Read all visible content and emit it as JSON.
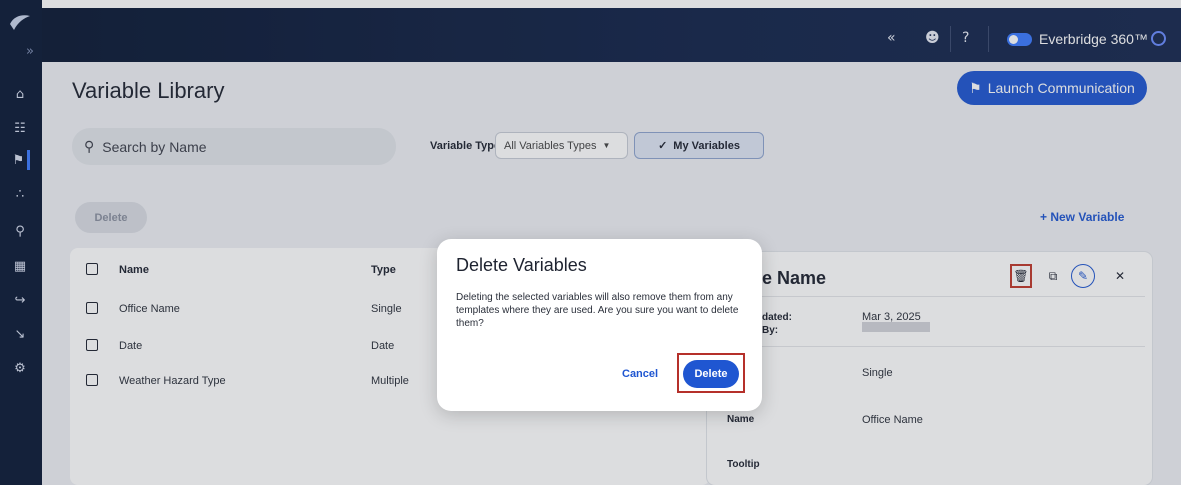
{
  "topbar": {
    "collapse_glyph": "«",
    "brand": "Everbridge 360™",
    "icons": [
      "user-icon",
      "help-icon",
      "toggle-switch",
      "profile-icon"
    ]
  },
  "sidebar": {
    "expand_glyph": "»",
    "items": [
      "home-icon",
      "dashboard-icon",
      "communications-icon",
      "incidents-icon",
      "location-icon",
      "calendar-icon",
      "workflow-icon",
      "reports-icon",
      "settings-icon"
    ]
  },
  "page": {
    "title": "Variable Library",
    "launch_label": "Launch Communication",
    "search_placeholder": "Search by Name",
    "variable_type_label": "Variable Type",
    "variable_type_value": "All Variables Types",
    "my_variables_label": "My Variables",
    "delete_label": "Delete",
    "new_variable_label": "+ New Variable"
  },
  "table": {
    "headers": [
      "Name",
      "Type"
    ],
    "rows": [
      {
        "name": "Office Name",
        "type": "Single"
      },
      {
        "name": "Date",
        "type": "Date"
      },
      {
        "name": "Weather Hazard Type",
        "type": "Multiple"
      }
    ]
  },
  "detail": {
    "title_fragment": "e Name",
    "updated_label": "dated:",
    "updated_value": "Mar 3, 2025",
    "by_label": "By:",
    "type_value": "Single",
    "name_label": "Name",
    "name_value": "Office Name",
    "tooltip_label": "Tooltip"
  },
  "modal": {
    "title": "Delete Variables",
    "body": "Deleting the selected variables will also remove them from any templates where they are used. Are you sure you want to delete them?",
    "cancel_label": "Cancel",
    "delete_label": "Delete"
  },
  "colors": {
    "accent": "#1f56d1",
    "topbar": "#13244a",
    "highlight": "#b5302a"
  }
}
